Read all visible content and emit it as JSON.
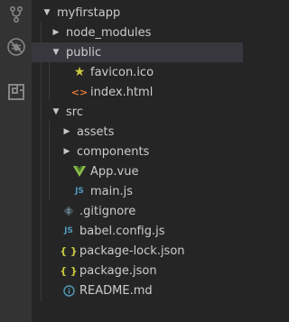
{
  "explorer": {
    "root": "myfirstapp",
    "items": [
      {
        "label": "node_modules"
      },
      {
        "label": "public"
      },
      {
        "label": "favicon.ico"
      },
      {
        "label": "index.html"
      },
      {
        "label": "src"
      },
      {
        "label": "assets"
      },
      {
        "label": "components"
      },
      {
        "label": "App.vue"
      },
      {
        "label": "main.js"
      },
      {
        "label": ".gitignore"
      },
      {
        "label": "babel.config.js"
      },
      {
        "label": "package-lock.json"
      },
      {
        "label": "package.json"
      },
      {
        "label": "README.md"
      }
    ],
    "badges": {
      "js": "JS",
      "json": "{ }"
    }
  },
  "activity_bar": [
    "source-control-icon",
    "debug-icon",
    "extensions-icon"
  ],
  "colors": {
    "sidebar_bg": "#252526",
    "activity_bg": "#333333",
    "selected_bg": "#37373d",
    "text": "#cccccc",
    "js_blue": "#519aba",
    "json_yellow": "#cbcb41",
    "html_orange": "#e37933",
    "vue_green": "#8dc149",
    "info_blue": "#519aba"
  }
}
